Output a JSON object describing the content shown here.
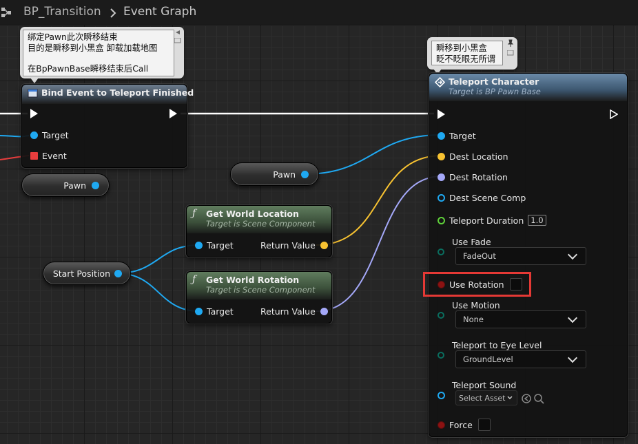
{
  "header": {
    "blueprint": "BP_Transition",
    "graph": "Event Graph"
  },
  "colors": {
    "object_pin": "#1fa9f2",
    "vector_pin": "#f7c231",
    "rotator_pin": "#a4a8f8",
    "float_pin": "#5fd13a",
    "delegate_pin": "#e83d3d",
    "bool_pin": "#8c1212",
    "enum_pin": "#0a6d5e"
  },
  "comments": {
    "bind_comment": [
      "绑定Pawn此次瞬移结束",
      "目的是瞬移到小黑盒 卸载加载地图",
      "",
      "在BpPawnBase瞬移结束后Call"
    ],
    "teleport_comment": [
      "瞬移到小黑盒",
      "眨不眨眼无所谓"
    ]
  },
  "bind_node": {
    "title": "Bind Event to Teleport Finished",
    "pin_target": "Target",
    "pin_event": "Event"
  },
  "pawn_var_left": {
    "label": "Pawn"
  },
  "pawn_var_mid": {
    "label": "Pawn"
  },
  "start_position": {
    "label": "Start Position"
  },
  "get_location": {
    "title": "Get World Location",
    "subtitle": "Target is Scene Component",
    "pin_target": "Target",
    "pin_return": "Return Value"
  },
  "get_rotation": {
    "title": "Get World Rotation",
    "subtitle": "Target is Scene Component",
    "pin_target": "Target",
    "pin_return": "Return Value"
  },
  "teleport": {
    "title": "Teleport Character",
    "subtitle": "Target is BP Pawn Base",
    "pin_target": "Target",
    "pin_dest_location": "Dest Location",
    "pin_dest_rotation": "Dest Rotation",
    "pin_dest_scene_comp": "Dest Scene Comp",
    "pin_duration": "Teleport Duration",
    "duration_value": "1.0",
    "pin_use_fade": "Use Fade",
    "use_fade_value": "FadeOut",
    "pin_use_rotation": "Use Rotation",
    "use_rotation_checked": false,
    "pin_use_motion": "Use Motion",
    "use_motion_value": "None",
    "pin_eye_level": "Teleport to Eye Level",
    "eye_level_value": "GroundLevel",
    "pin_sound": "Teleport Sound",
    "sound_value": "Select Asset",
    "pin_force": "Force",
    "force_checked": false
  }
}
